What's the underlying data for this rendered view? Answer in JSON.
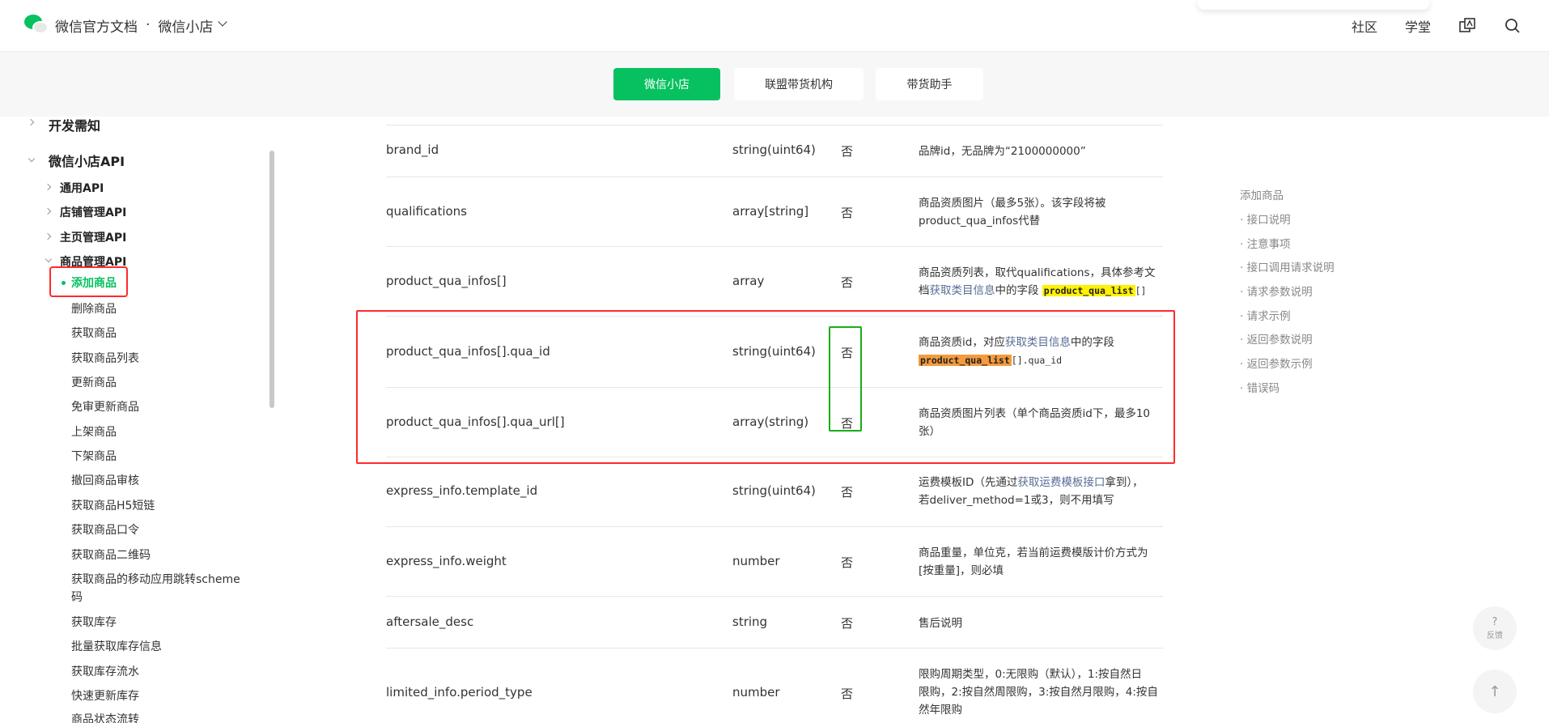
{
  "header": {
    "doc_title": "微信官方文档",
    "separator": "·",
    "product": "微信小店",
    "nav": [
      "社区",
      "学堂"
    ]
  },
  "tabs": [
    {
      "label": "微信小店",
      "active": true
    },
    {
      "label": "联盟带货机构",
      "active": false
    },
    {
      "label": "带货助手",
      "active": false
    }
  ],
  "sidebar": {
    "dev_notice": "开发需知",
    "api_group": "微信小店API",
    "subgroups": [
      "通用API",
      "店铺管理API",
      "主页管理API",
      "商品管理API"
    ],
    "items": [
      "添加商品",
      "删除商品",
      "获取商品",
      "获取商品列表",
      "更新商品",
      "免审更新商品",
      "上架商品",
      "下架商品",
      "撤回商品审核",
      "获取商品H5短链",
      "获取商品口令",
      "获取商品二维码",
      "获取商品的移动应用跳转scheme",
      "码",
      "获取库存",
      "批量获取库存信息",
      "获取库存流水",
      "快速更新库存",
      "商品状态流转"
    ]
  },
  "table": {
    "rows": [
      {
        "name": "brand_id",
        "type": "string(uint64)",
        "required": "否",
        "desc": "品牌id，无品牌为“2100000000”"
      },
      {
        "name": "qualifications",
        "type": "array[string]",
        "required": "否",
        "desc1": "商品资质图片（最多5张）。该字段将被",
        "desc2": "product_qua_infos代替"
      },
      {
        "name": "product_qua_infos[]",
        "type": "array",
        "required": "否",
        "desc1": "商品资质列表，取代qualifications，具体参考文",
        "desc2a": "档",
        "desc2link": "获取类目信息",
        "desc2b": "中的字段",
        "desc2code": "product_qua_list",
        "desc2tail": "[]"
      },
      {
        "name": "product_qua_infos[].qua_id",
        "type": "string(uint64)",
        "required": "否",
        "desc1a": "商品资质id，对应",
        "desc1link": "获取类目信息",
        "desc1b": "中的字段",
        "desc2code": "product_qua_list",
        "desc2tail": "[].qua_id"
      },
      {
        "name": "product_qua_infos[].qua_url[]",
        "type": "array(string)",
        "required": "否",
        "desc1": "商品资质图片列表（单个商品资质id下，最多10",
        "desc2": "张）"
      },
      {
        "name": "express_info.template_id",
        "type": "string(uint64)",
        "required": "否",
        "desc1a": "运费模板ID（先通过",
        "desc1link": "获取运费模板接口",
        "desc1b": "拿到），",
        "desc2": "若deliver_method=1或3，则不用填写"
      },
      {
        "name": "express_info.weight",
        "type": "number",
        "required": "否",
        "desc1": "商品重量，单位克，若当前运费模版计价方式为",
        "desc2": "[按重量]，则必填"
      },
      {
        "name": "aftersale_desc",
        "type": "string",
        "required": "否",
        "desc": "售后说明"
      },
      {
        "name": "limited_info.period_type",
        "type": "number",
        "required": "否",
        "desc1": "限购周期类型，0:无限购（默认），1:按自然日",
        "desc2": "限购，2:按自然周限购，3:按自然月限购，4:按自",
        "desc3": "然年限购"
      }
    ]
  },
  "toc": {
    "title": "添加商品",
    "items": [
      "· 接口说明",
      "· 注意事项",
      "· 接口调用请求说明",
      "· 请求参数说明",
      "· 请求示例",
      "· 返回参数说明",
      "· 返回参数示例",
      "· 错误码"
    ]
  },
  "fab": {
    "feedback_icon": "?",
    "feedback_label": "反馈",
    "top_icon": "↑"
  },
  "colors": {
    "accent": "#07c160",
    "highlight_red": "#ff2a2a",
    "highlight_green": "#1aad19"
  }
}
